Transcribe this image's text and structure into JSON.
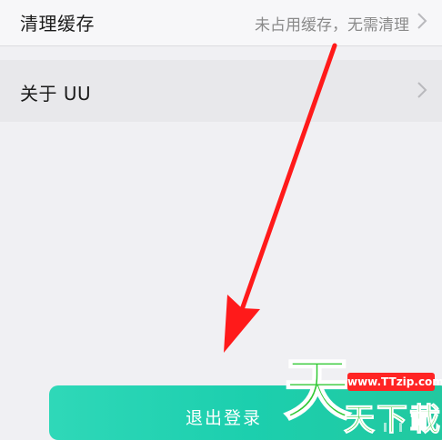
{
  "settings": {
    "clear_cache": {
      "label": "清理缓存",
      "value": "未占用缓存，无需清理"
    },
    "about": {
      "label": "关于 UU"
    }
  },
  "logout_button": {
    "label": "退出登录"
  },
  "annotation": {
    "arrow_color": "#ff1a1a"
  },
  "watermark": {
    "big_char": "天",
    "url": "www.TTzip.com",
    "chars": "天下載"
  },
  "colors": {
    "logout_start": "#2fd8b8",
    "logout_end": "#22c89f",
    "watermark_green": "#2fc832"
  }
}
